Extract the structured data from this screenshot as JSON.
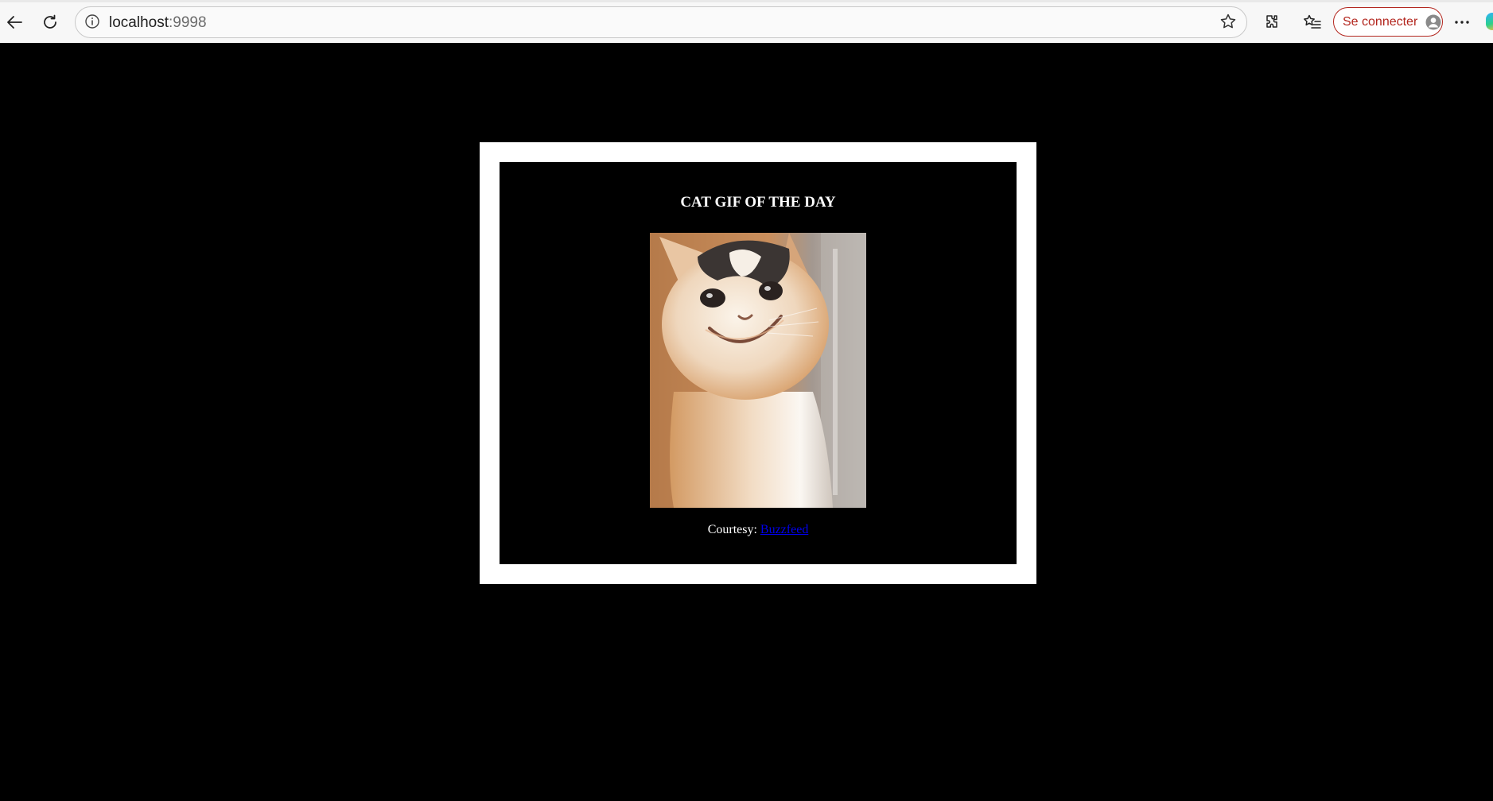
{
  "browser": {
    "url_host": "localhost",
    "url_port": ":9998",
    "signin_label": "Se connecter",
    "accent_color": "#b3261e",
    "icons": [
      "back-arrow-icon",
      "reload-icon",
      "site-info-icon",
      "favorite-star-icon",
      "extensions-icon",
      "favorites-list-icon",
      "avatar-icon",
      "more-options-icon",
      "edge-logo-icon"
    ]
  },
  "page": {
    "background_color": "#000000",
    "frame_color": "#ffffff",
    "title": "CAT GIF OF THE DAY",
    "image_subject": "smiling white cat gif",
    "courtesy_prefix": "Courtesy:",
    "courtesy_link": "Buzzfeed",
    "link_color": "#0000ee"
  }
}
